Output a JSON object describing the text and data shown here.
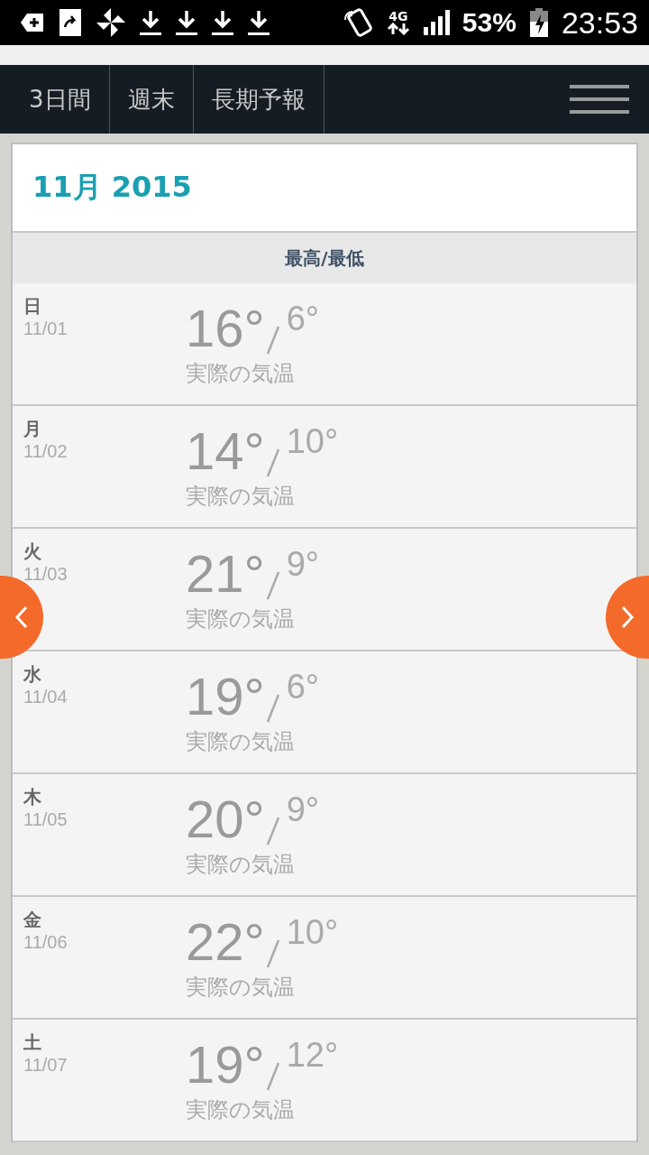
{
  "status_bar": {
    "network": "4G",
    "battery": "53%",
    "time": "23:53"
  },
  "tabs": [
    "3日間",
    "週末",
    "長期予報"
  ],
  "month": "11月 2015",
  "column_header": "最高/最低",
  "days": [
    {
      "weekday": "日",
      "date": "11/01",
      "high": "16°",
      "low": "6°",
      "note": "実際の気温"
    },
    {
      "weekday": "月",
      "date": "11/02",
      "high": "14°",
      "low": "10°",
      "note": "実際の気温"
    },
    {
      "weekday": "火",
      "date": "11/03",
      "high": "21°",
      "low": "9°",
      "note": "実際の気温"
    },
    {
      "weekday": "水",
      "date": "11/04",
      "high": "19°",
      "low": "6°",
      "note": "実際の気温"
    },
    {
      "weekday": "木",
      "date": "11/05",
      "high": "20°",
      "low": "9°",
      "note": "実際の気温"
    },
    {
      "weekday": "金",
      "date": "11/06",
      "high": "22°",
      "low": "10°",
      "note": "実際の気温"
    },
    {
      "weekday": "土",
      "date": "11/07",
      "high": "19°",
      "low": "12°",
      "note": "実際の気温"
    }
  ]
}
